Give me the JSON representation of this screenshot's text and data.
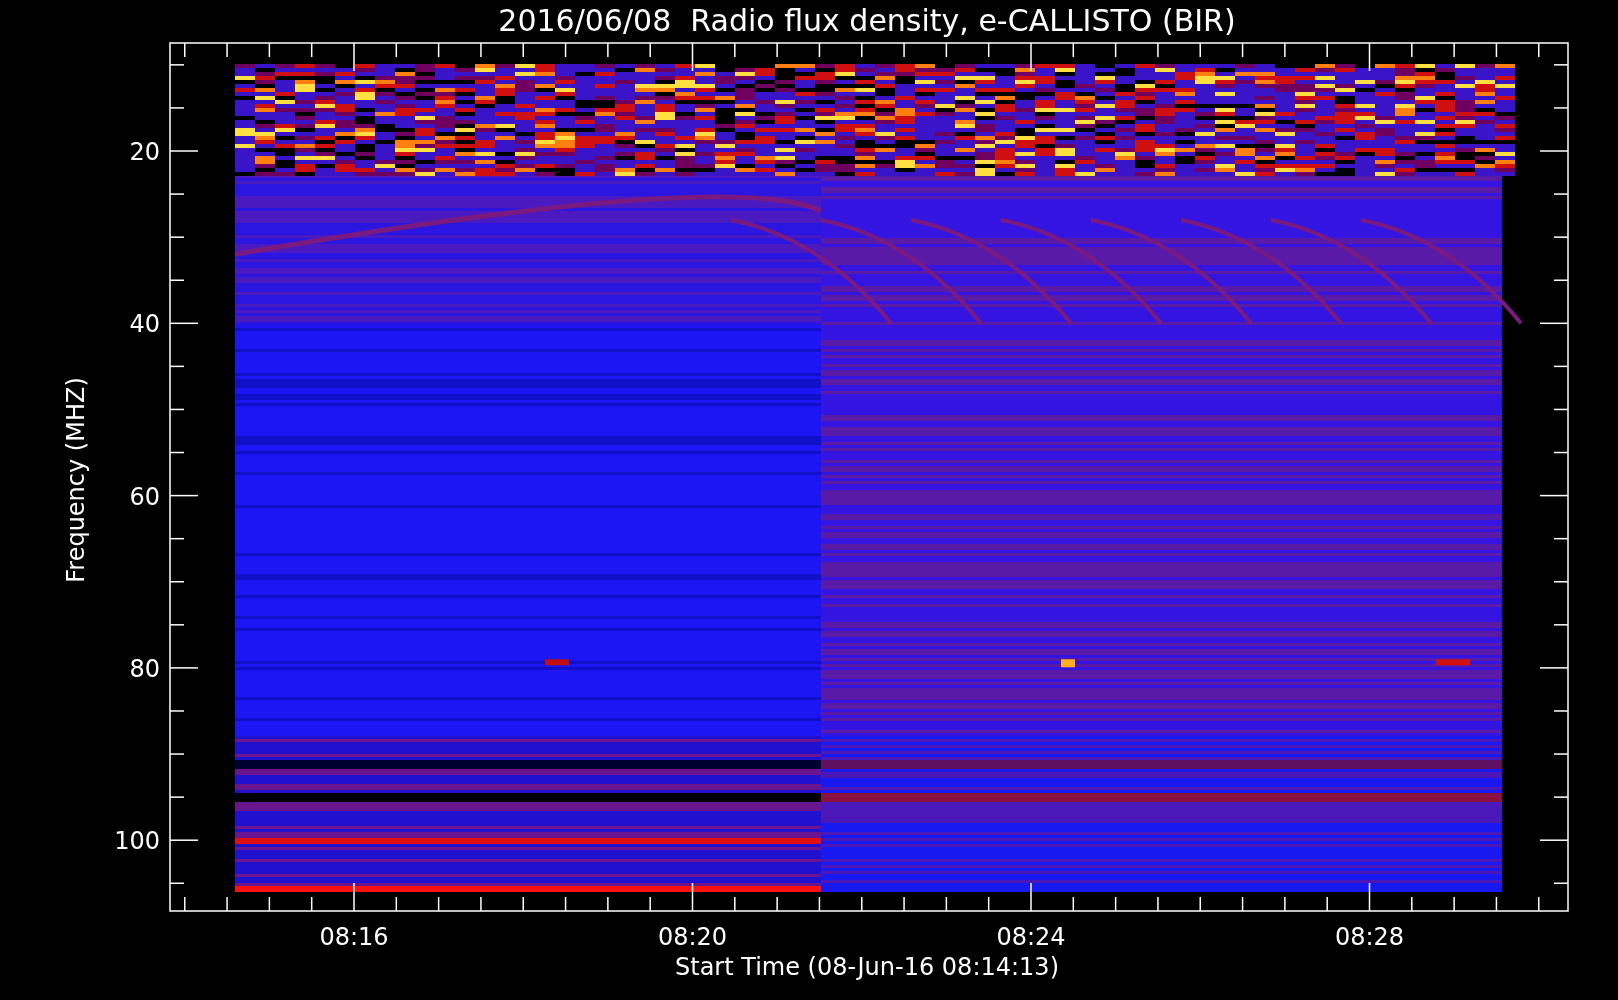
{
  "title": "2016/06/08  Radio flux density, e-CALLISTO (BIR)",
  "y_axis": {
    "label": "Frequency (MHZ)",
    "ticks": [
      "20",
      "40",
      "60",
      "80",
      "100"
    ]
  },
  "x_axis": {
    "label": "Start Time (08-Jun-16 08:14:13)",
    "ticks": [
      "08:16",
      "08:20",
      "08:24",
      "08:28"
    ]
  }
}
